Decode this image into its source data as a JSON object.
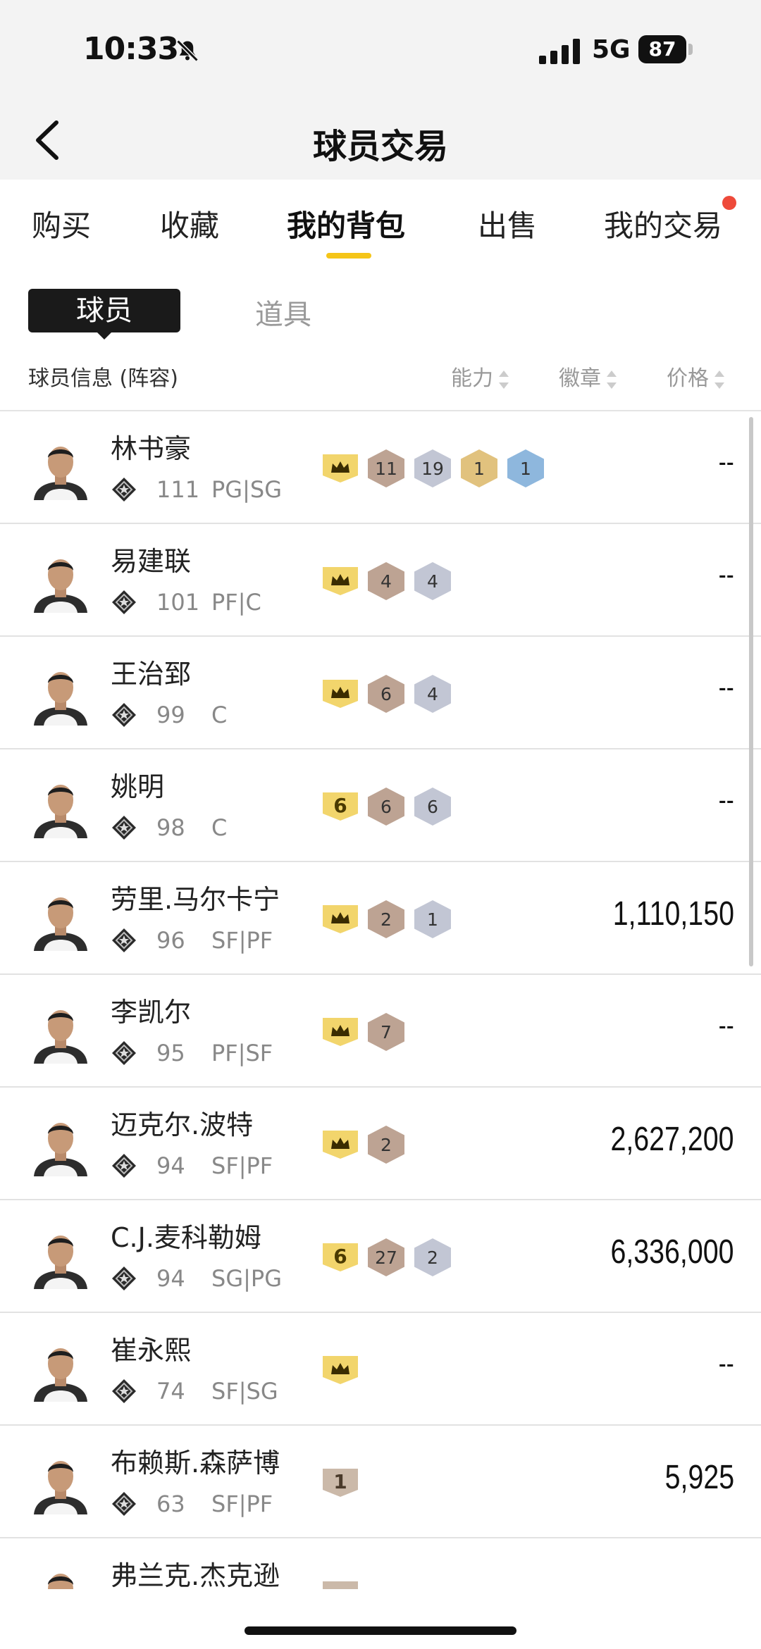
{
  "status_bar": {
    "time": "10:33",
    "network": "5G",
    "battery": "87"
  },
  "nav": {
    "title": "球员交易"
  },
  "tabs": [
    {
      "label": "购买",
      "active": false
    },
    {
      "label": "收藏",
      "active": false
    },
    {
      "label": "我的背包",
      "active": true
    },
    {
      "label": "出售",
      "active": false
    },
    {
      "label": "我的交易",
      "active": false,
      "has_dot": true
    }
  ],
  "segments": {
    "active": "球员",
    "inactive": "道具"
  },
  "columns": {
    "info": "球员信息 (阵容)",
    "ability": "能力",
    "badge": "徽章",
    "price": "价格"
  },
  "players": [
    {
      "name": "林书豪",
      "ovr": "111",
      "pos": "PG|SG",
      "ability": {
        "type": "crown"
      },
      "badges": [
        {
          "tier": "bronze",
          "count": "11"
        },
        {
          "tier": "silver",
          "count": "19"
        },
        {
          "tier": "gold",
          "count": "1"
        },
        {
          "tier": "hof",
          "count": "1"
        }
      ],
      "price": "--"
    },
    {
      "name": "易建联",
      "ovr": "101",
      "pos": "PF|C",
      "ability": {
        "type": "crown"
      },
      "badges": [
        {
          "tier": "bronze",
          "count": "4"
        },
        {
          "tier": "silver",
          "count": "4"
        }
      ],
      "price": "--"
    },
    {
      "name": "王治郅",
      "ovr": "99",
      "pos": "C",
      "ability": {
        "type": "crown"
      },
      "badges": [
        {
          "tier": "bronze",
          "count": "6"
        },
        {
          "tier": "silver",
          "count": "4"
        }
      ],
      "price": "--"
    },
    {
      "name": "姚明",
      "ovr": "98",
      "pos": "C",
      "ability": {
        "type": "number",
        "value": "6"
      },
      "badges": [
        {
          "tier": "bronze",
          "count": "6"
        },
        {
          "tier": "silver",
          "count": "6"
        }
      ],
      "price": "--"
    },
    {
      "name": "劳里.马尔卡宁",
      "ovr": "96",
      "pos": "SF|PF",
      "ability": {
        "type": "crown"
      },
      "badges": [
        {
          "tier": "bronze",
          "count": "2"
        },
        {
          "tier": "silver",
          "count": "1"
        }
      ],
      "price": "1,110,150"
    },
    {
      "name": "李凯尔",
      "ovr": "95",
      "pos": "PF|SF",
      "ability": {
        "type": "crown"
      },
      "badges": [
        {
          "tier": "bronze",
          "count": "7"
        }
      ],
      "price": "--"
    },
    {
      "name": "迈克尔.波特",
      "ovr": "94",
      "pos": "SF|PF",
      "ability": {
        "type": "crown"
      },
      "badges": [
        {
          "tier": "bronze",
          "count": "2"
        }
      ],
      "price": "2,627,200"
    },
    {
      "name": "C.J.麦科勒姆",
      "ovr": "94",
      "pos": "SG|PG",
      "ability": {
        "type": "number",
        "value": "6"
      },
      "badges": [
        {
          "tier": "bronze",
          "count": "27"
        },
        {
          "tier": "silver",
          "count": "2"
        }
      ],
      "price": "6,336,000"
    },
    {
      "name": "崔永熙",
      "ovr": "74",
      "pos": "SF|SG",
      "ability": {
        "type": "crown"
      },
      "badges": [],
      "price": "--"
    },
    {
      "name": "布赖斯.森萨博",
      "ovr": "63",
      "pos": "SF|PF",
      "ability": {
        "type": "plain",
        "value": "1"
      },
      "badges": [],
      "price": "5,925"
    },
    {
      "name": "弗兰克.杰克逊",
      "ovr": "",
      "pos": "",
      "ability": {
        "type": "plain",
        "value": ""
      },
      "badges": [],
      "price": ""
    }
  ],
  "colors": {
    "accent": "#f5c518",
    "notification": "#ee4a3a"
  }
}
